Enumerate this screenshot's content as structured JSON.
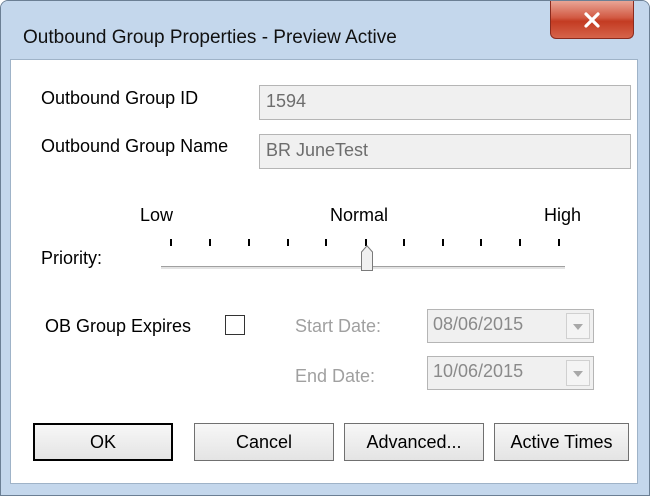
{
  "window": {
    "title": "Outbound Group Properties - Preview Active",
    "close_icon": "close-icon"
  },
  "fields": {
    "group_id_label": "Outbound Group ID",
    "group_id_value": "1594",
    "group_name_label": "Outbound Group Name",
    "group_name_value": "BR JuneTest"
  },
  "priority": {
    "label": "Priority:",
    "low_label": "Low",
    "normal_label": "Normal",
    "high_label": "High",
    "tick_count": 11,
    "selected_index": 5
  },
  "expires": {
    "label": "OB Group Expires",
    "checked": false,
    "start_label": "Start Date:",
    "start_value": "08/06/2015",
    "end_label": "End Date:",
    "end_value": "10/06/2015"
  },
  "buttons": {
    "ok": "OK",
    "cancel": "Cancel",
    "advanced": "Advanced...",
    "active_times": "Active Times"
  }
}
